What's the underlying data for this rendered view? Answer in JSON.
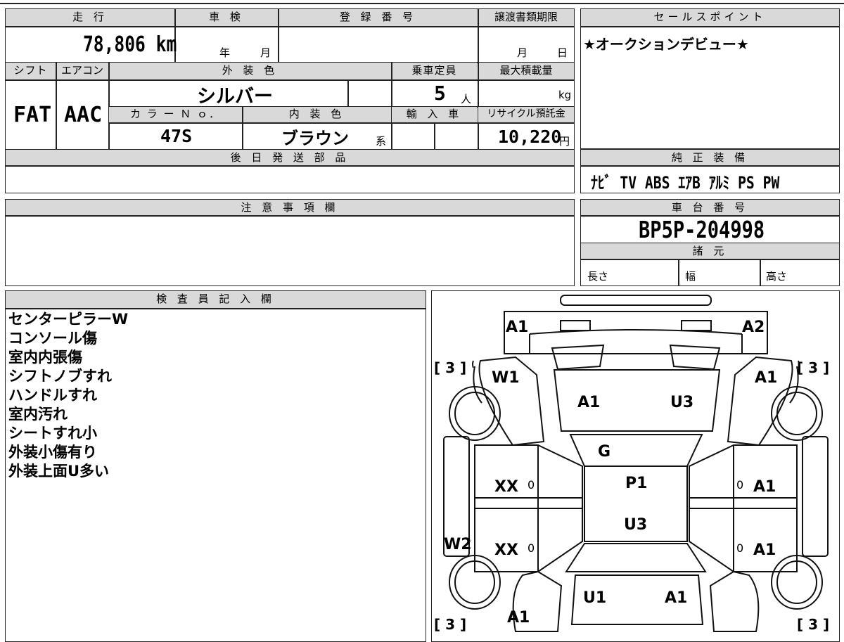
{
  "vehicle": {
    "mileage_label": "走 行",
    "mileage_value": "78,806",
    "mileage_unit": "km",
    "inspection_label": "車 検",
    "inspection_year_unit": "年",
    "inspection_month_unit": "月",
    "registration_label": "登 録 番 号",
    "transfer_deadline_label": "譲渡書類期限",
    "transfer_month_unit": "月",
    "transfer_day_unit": "日",
    "shift_label": "シフト",
    "shift_value": "FAT",
    "aircon_label": "エアコン",
    "aircon_value": "AAC",
    "exterior_color_label": "外 装 色",
    "exterior_color_value": "シルバー",
    "capacity_label": "乗車定員",
    "capacity_value": "5",
    "capacity_unit": "人",
    "max_load_label": "最大積載量",
    "max_load_unit": "kg",
    "color_no_label": "カ ラ ー Ｎ ｏ．",
    "color_no_value": "47S",
    "interior_color_label": "内 装 色",
    "interior_color_value": "ブラウン",
    "interior_color_suffix": "系",
    "import_label": "輸 入 車",
    "recycle_label": "リサイクル預託金",
    "recycle_value": "10,220",
    "recycle_unit": "円",
    "shipping_label": "後 日 発 送 部 品"
  },
  "sales_point": {
    "label": "セールスポイント",
    "text": "★オークションデビュー★"
  },
  "equipment": {
    "label": "純 正 装 備",
    "items": [
      "ﾅﾋﾞ",
      "TV",
      "ABS",
      "ｴｱB",
      "ｱﾙﾐ",
      "PS",
      "PW"
    ]
  },
  "notes": {
    "label": "注 意 事 項 欄"
  },
  "chassis": {
    "label": "車 台 番 号",
    "value": "BP5P-204998"
  },
  "specs": {
    "label": "諸 元",
    "length_label": "長さ",
    "width_label": "幅",
    "height_label": "高さ"
  },
  "inspector": {
    "label": "検 査 員 記 入 欄",
    "lines": [
      "センターピラーW",
      "コンソール傷",
      "室内内張傷",
      "シフトノブすれ",
      "ハンドルすれ",
      "室内汚れ",
      "シートすれ小",
      "外装小傷有り",
      "外装上面U多い"
    ]
  },
  "diagram": {
    "marks": {
      "front_left": "A1",
      "front_right": "A2",
      "fender_left": "W1",
      "fender_right": "A1",
      "hood_left": "A1",
      "hood_right": "U3",
      "windshield": "G",
      "roof_front": "P1",
      "roof_rear": "U3",
      "door_fl": "XX",
      "door_rl": "XX",
      "door_fr": "A1",
      "door_rr": "A1",
      "sill_left": "W2",
      "trunk_left": "U1",
      "trunk_right": "A1",
      "rear_left": "A1",
      "door_fl_zero": "0",
      "door_rl_zero": "0",
      "door_fr_zero": "0",
      "door_rr_zero": "0"
    },
    "tire_marks": {
      "front_left": "[ 3 ]",
      "front_right": "[ 3 ]",
      "rear_left": "[ 3 ]",
      "rear_right": "[ 3 ]"
    }
  }
}
